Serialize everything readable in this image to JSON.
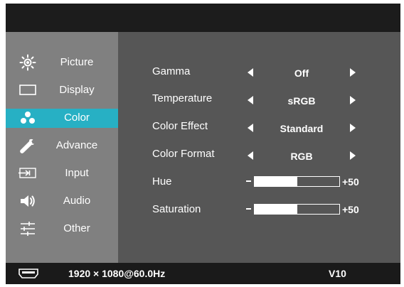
{
  "sidebar": {
    "items": [
      {
        "label": "Picture",
        "icon": "brightness-icon",
        "active": false
      },
      {
        "label": "Display",
        "icon": "display-icon",
        "active": false
      },
      {
        "label": "Color",
        "icon": "color-dots-icon",
        "active": true
      },
      {
        "label": "Advance",
        "icon": "wrench-icon",
        "active": false
      },
      {
        "label": "Input",
        "icon": "input-source-icon",
        "active": false
      },
      {
        "label": "Audio",
        "icon": "speaker-icon",
        "active": false
      },
      {
        "label": "Other",
        "icon": "sliders-icon",
        "active": false
      }
    ]
  },
  "settings": {
    "gamma": {
      "label": "Gamma",
      "value": "Off"
    },
    "temperature": {
      "label": "Temperature",
      "value": "sRGB"
    },
    "color_effect": {
      "label": "Color Effect",
      "value": "Standard"
    },
    "color_format": {
      "label": "Color Format",
      "value": "RGB"
    },
    "hue": {
      "label": "Hue",
      "value": "+50",
      "level": 0.5
    },
    "saturation": {
      "label": "Saturation",
      "value": "+50",
      "level": 0.5
    }
  },
  "status": {
    "resolution": "1920 × 1080@60.0Hz",
    "version": "V10",
    "connector_icon": "hdmi-icon"
  },
  "colors": {
    "accent": "#27b0c4",
    "sidebar": "#808080",
    "panel": "#565656"
  }
}
